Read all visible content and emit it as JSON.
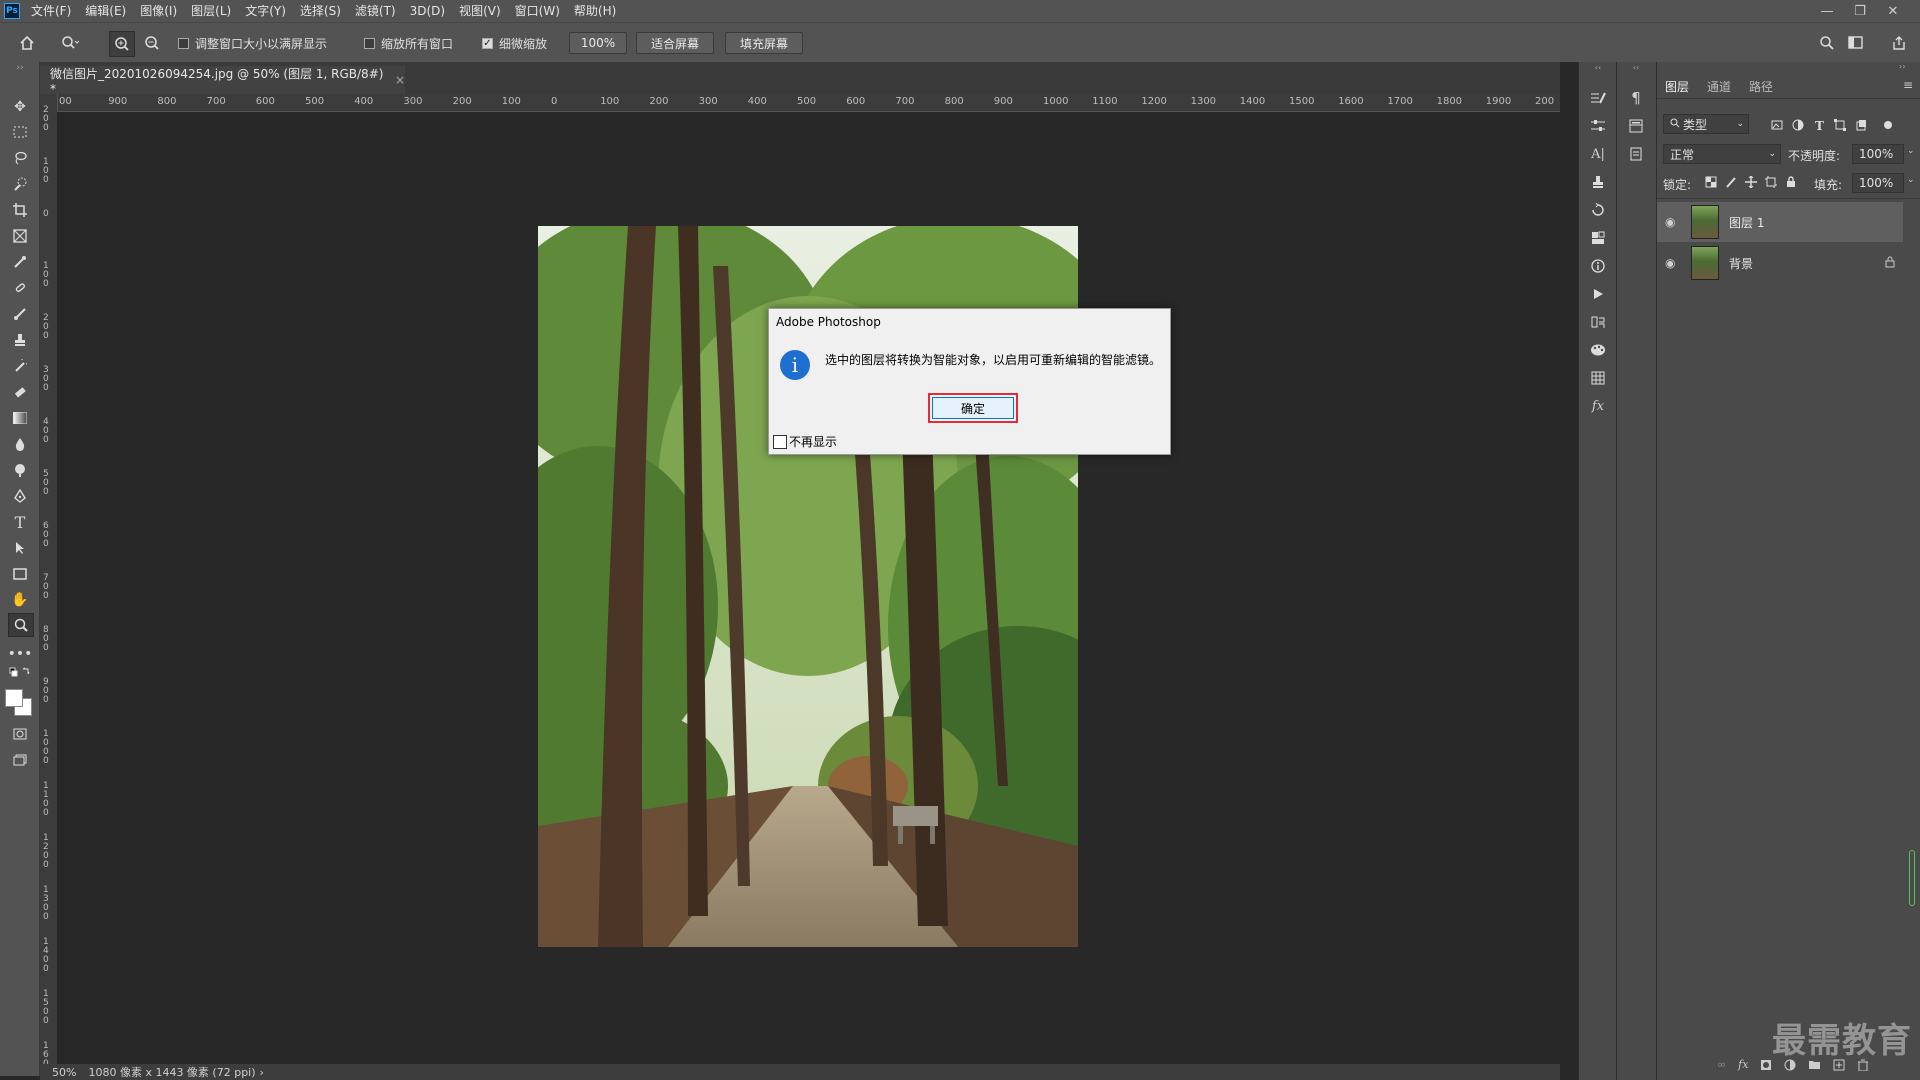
{
  "app": {
    "logo": "Ps",
    "menu": [
      "文件(F)",
      "编辑(E)",
      "图像(I)",
      "图层(L)",
      "文字(Y)",
      "选择(S)",
      "滤镜(T)",
      "3D(D)",
      "视图(V)",
      "窗口(W)",
      "帮助(H)"
    ],
    "window_controls": {
      "minimize": "—",
      "restore": "❐",
      "close": "✕"
    }
  },
  "options_bar": {
    "resize_windows_label": "调整窗口大小以满屏显示",
    "resize_windows_checked": false,
    "zoom_all_label": "缩放所有窗口",
    "zoom_all_checked": false,
    "scrubby_label": "细微缩放",
    "scrubby_checked": true,
    "zoom_value": "100%",
    "fit_screen_label": "适合屏幕",
    "fill_screen_label": "填充屏幕"
  },
  "document": {
    "tab_title": "微信图片_20201026094254.jpg @ 50% (图层 1, RGB/8#) *",
    "tab_close": "×"
  },
  "ruler": {
    "h_labels": [
      "00",
      "900",
      "800",
      "700",
      "600",
      "500",
      "400",
      "300",
      "200",
      "100",
      "0",
      "100",
      "200",
      "300",
      "400",
      "500",
      "600",
      "700",
      "800",
      "900",
      "1000",
      "1100",
      "1200",
      "1300",
      "1400",
      "1500",
      "1600",
      "1700",
      "1800",
      "1900",
      "200"
    ],
    "v_labels": [
      "200",
      "100",
      "0",
      "100",
      "200",
      "300",
      "400",
      "500",
      "600",
      "700",
      "800",
      "900",
      "1000",
      "1100",
      "1200",
      "1300",
      "1400",
      "1500",
      "1600"
    ]
  },
  "status": {
    "zoom": "50%",
    "info": "1080 像素 x 1443 像素 (72 ppi)",
    "arrow": "›"
  },
  "dialog": {
    "title": "Adobe Photoshop",
    "message": "选中的图层将转换为智能对象，以启用可重新编辑的智能滤镜。",
    "ok_label": "确定",
    "dont_show_label": "不再显示",
    "dont_show_checked": false,
    "highlight_color": "#e52b35"
  },
  "layers_panel": {
    "tabs": [
      "图层",
      "通道",
      "路径"
    ],
    "filter_kind": "类型",
    "blend_mode": "正常",
    "opacity_label": "不透明度:",
    "opacity_value": "100%",
    "lock_label": "锁定:",
    "fill_label": "填充:",
    "fill_value": "100%",
    "layers": [
      {
        "name": "图层 1",
        "selected": true,
        "locked": false
      },
      {
        "name": "背景",
        "selected": false,
        "locked": true
      }
    ]
  },
  "watermark": "最需教育"
}
